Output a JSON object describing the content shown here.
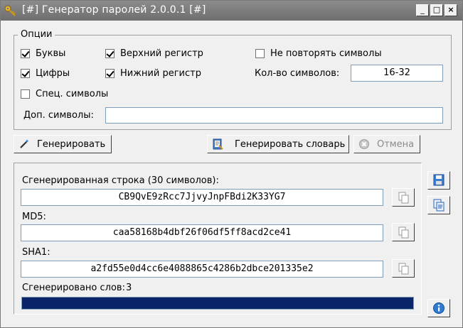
{
  "window": {
    "title": "[#] Генератор паролей 2.0.0.1 [#]",
    "min_label": "_",
    "max_label": "□",
    "close_label": "×"
  },
  "options": {
    "legend": "Опции",
    "letters": {
      "label": "Буквы",
      "checked": true
    },
    "digits": {
      "label": "Цифры",
      "checked": true
    },
    "special": {
      "label": "Спец. символы",
      "checked": false
    },
    "upper": {
      "label": "Верхний регистр",
      "checked": true
    },
    "lower": {
      "label": "Нижний регистр",
      "checked": true
    },
    "no_repeat": {
      "label": "Не повторять символы",
      "checked": false
    },
    "length_label": "Кол-во символов:",
    "length_value": "16-32",
    "extra_label": "Доп. символы:",
    "extra_value": ""
  },
  "actions": {
    "generate": "Генерировать",
    "generate_dict": "Генерировать словарь",
    "cancel": "Отмена"
  },
  "results": {
    "string_label": "Сгенерированная строка (30 символов):",
    "string_value": "CB9QvE9zRcc7JjvyJnpFBdi2K33YG7",
    "md5_label": "MD5:",
    "md5_value": "caa58168b4dbf26f06df5ff8acd2ce41",
    "sha1_label": "SHA1:",
    "sha1_value": "a2fd55e0d4cc6e4088865c4286b2dbce201335e2",
    "words_label": "Сгенерировано слов:",
    "words_count": "3",
    "progress": 1.0
  },
  "colors": {
    "progress": "#0a246a",
    "titlebar": "#7a7a7a"
  }
}
